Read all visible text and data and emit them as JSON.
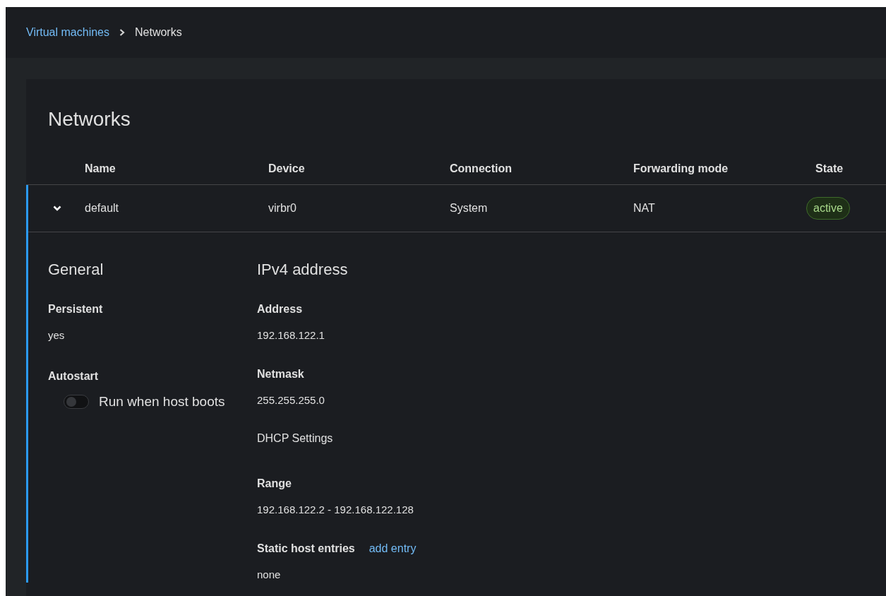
{
  "breadcrumb": {
    "items": [
      {
        "label": "Virtual machines",
        "kind": "link"
      },
      {
        "label": "Networks",
        "kind": "current"
      }
    ]
  },
  "title": "Networks",
  "table": {
    "columns": [
      "Name",
      "Device",
      "Connection",
      "Forwarding mode",
      "State"
    ],
    "rows": [
      {
        "expanded": true,
        "name": "default",
        "device": "virbr0",
        "connection": "System",
        "forwarding_mode": "NAT",
        "state": "active",
        "details": {
          "general": {
            "heading": "General",
            "persistent_label": "Persistent",
            "persistent_value": "yes",
            "autostart_label": "Autostart",
            "autostart_switch": {
              "label": "Run when host boots",
              "on": false
            }
          },
          "ipv4": {
            "heading": "IPv4 address",
            "items": [
              {
                "kind": "field",
                "label": "Address",
                "value": "192.168.122.1"
              },
              {
                "kind": "field",
                "label": "Netmask",
                "value": "255.255.255.0"
              },
              {
                "kind": "subheading",
                "label": "DHCP Settings"
              },
              {
                "kind": "field",
                "label": "Range",
                "value": "192.168.122.2 - 192.168.122.128"
              },
              {
                "kind": "field_link",
                "label": "Static host entries",
                "link": "add entry",
                "value": "none"
              }
            ]
          }
        }
      }
    ]
  }
}
